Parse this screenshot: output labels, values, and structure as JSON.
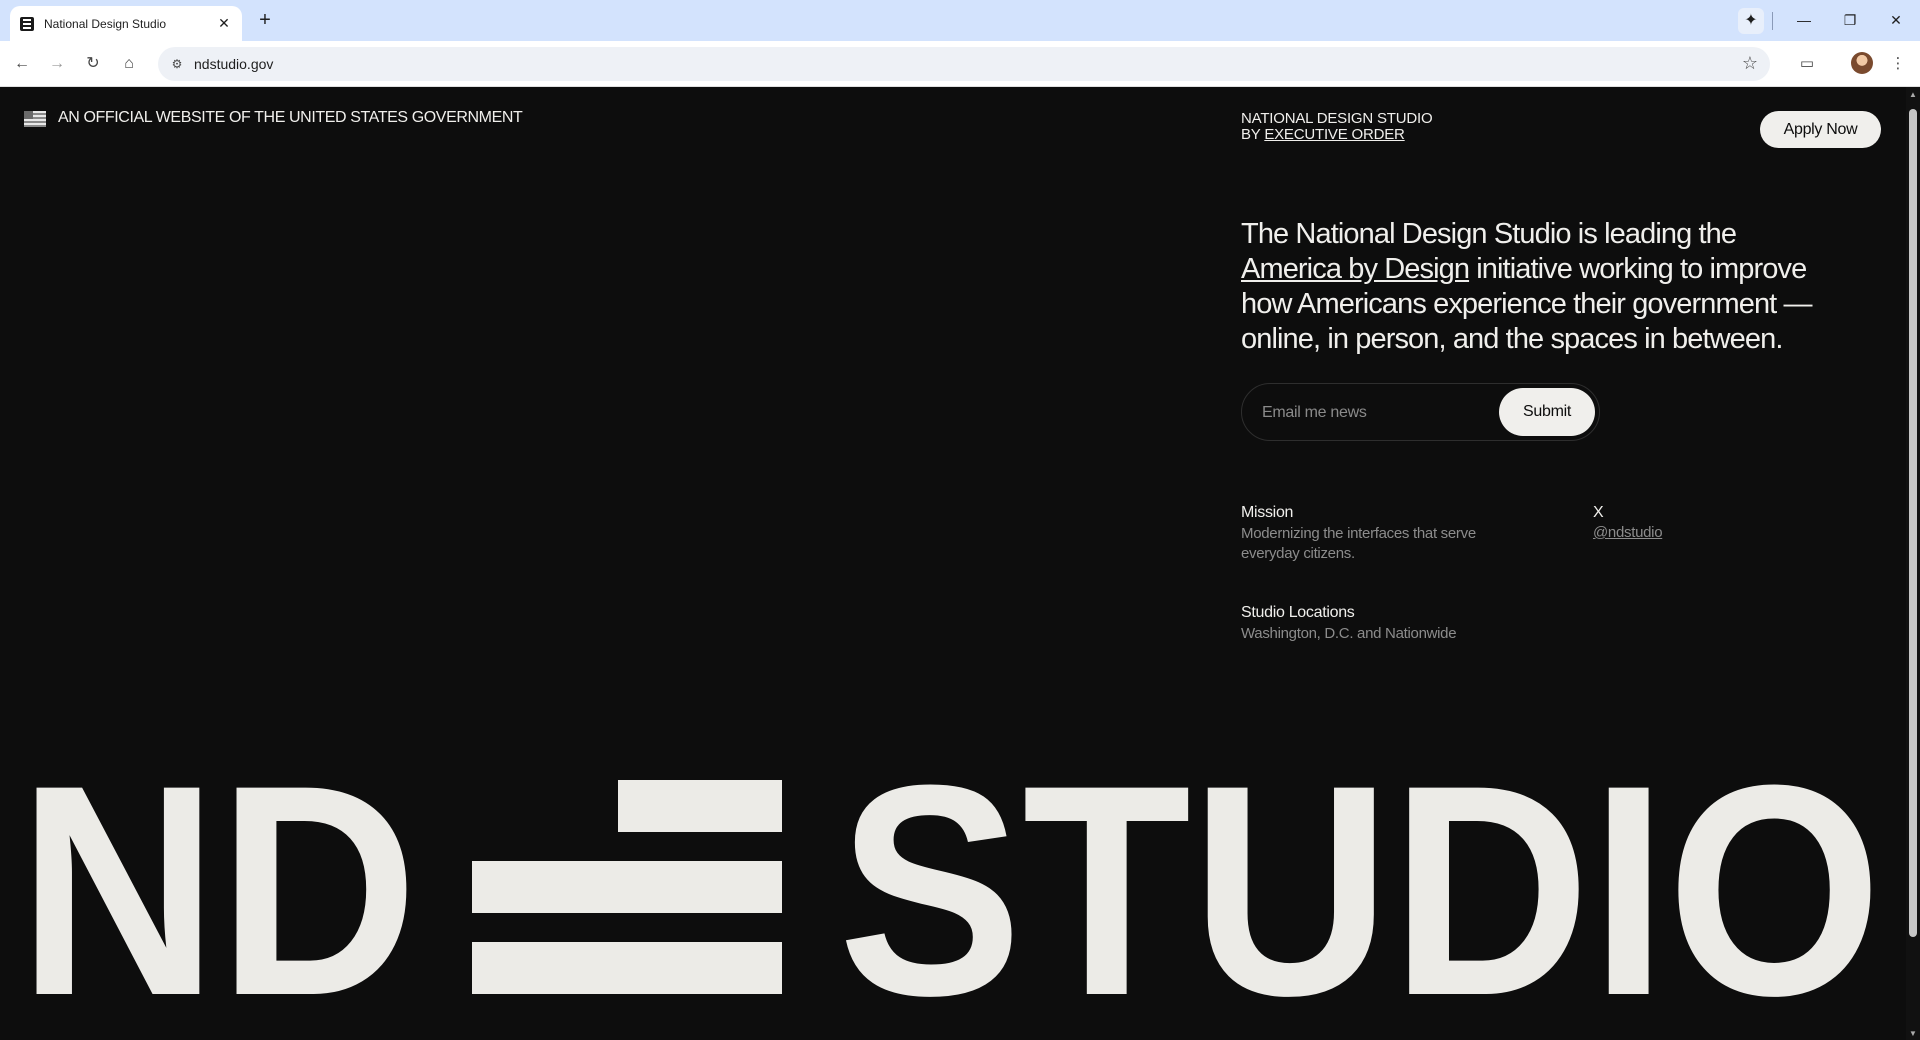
{
  "browser": {
    "tab_title": "National Design Studio",
    "tab_close": "✕",
    "new_tab": "+",
    "url": "ndstudio.gov",
    "window_controls": {
      "minimize": "—",
      "restore": "❐",
      "close": "✕"
    }
  },
  "header": {
    "official_notice": "AN OFFICIAL WEBSITE OF THE UNITED STATES GOVERNMENT",
    "brand_line1": "NATIONAL DESIGN STUDIO",
    "brand_by": "BY ",
    "brand_link": "EXECUTIVE ORDER",
    "apply_label": "Apply Now"
  },
  "lead": {
    "text_before": "The National Design Studio is leading the ",
    "link": "America by Design",
    "text_after": " initiative working to improve how Americans experience their government — online, in person, and the spaces in between."
  },
  "newsletter": {
    "placeholder": "Email me news",
    "submit_label": "Submit"
  },
  "info": {
    "mission_title": "Mission",
    "mission_text": "Modernizing the interfaces that serve everyday citizens.",
    "social_title": "X",
    "social_handle": "@ndstudio",
    "locations_title": "Studio Locations",
    "locations_text": "Washington, D.C. and Nationwide"
  },
  "logo": {
    "text_left": "ND",
    "text_right": "STUDIO",
    "color": "#ecebe7"
  },
  "colors": {
    "background": "#0d0d0d",
    "foreground": "#f0efec",
    "muted": "#8c8c8c",
    "browser_tabbar": "#d3e3fd"
  }
}
